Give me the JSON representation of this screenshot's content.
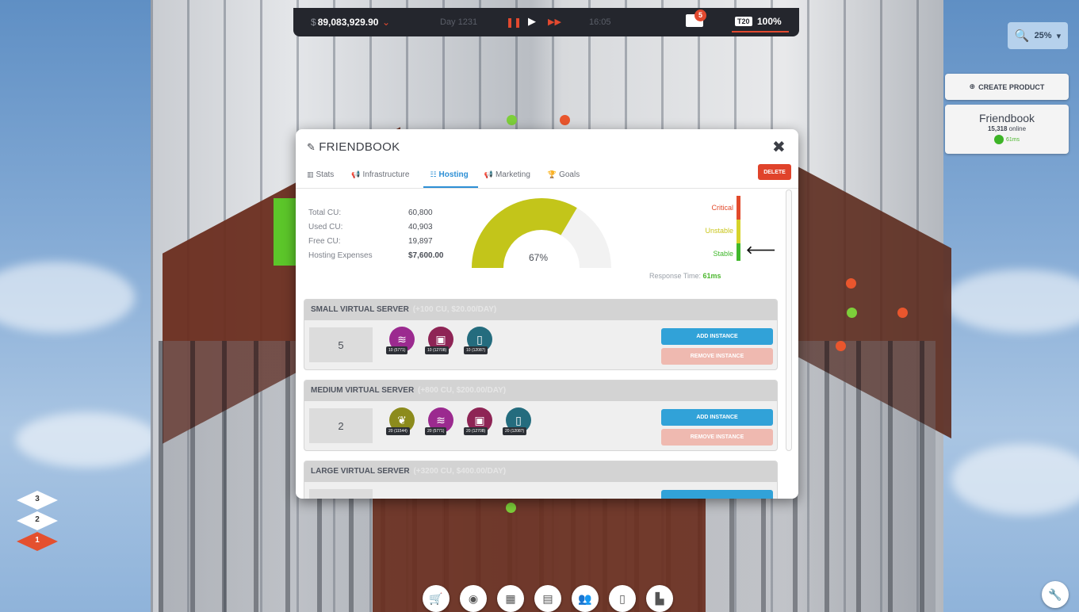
{
  "hud": {
    "currency_symbol": "$",
    "money": "89,083,929.90",
    "day": "Day 1231",
    "time": "16:05",
    "mail_count": "5",
    "perf_tag": "T20",
    "perf_value": "100%"
  },
  "zoom": {
    "value": "25%"
  },
  "side_panel": {
    "create_label": "CREATE PRODUCT",
    "product_name": "Friendbook",
    "online_count": "15,318",
    "online_suffix": "online",
    "latency": "61ms"
  },
  "floors": [
    "3",
    "2",
    "1"
  ],
  "active_floor": "1",
  "modal": {
    "title": "FRIENDBOOK",
    "delete_label": "DELETE",
    "tabs": [
      {
        "label": "Stats",
        "icon": "bar-chart-icon"
      },
      {
        "label": "Infrastructure",
        "icon": "megaphone-icon"
      },
      {
        "label": "Hosting",
        "icon": "server-icon"
      },
      {
        "label": "Marketing",
        "icon": "megaphone-icon"
      },
      {
        "label": "Goals",
        "icon": "trophy-icon"
      }
    ],
    "active_tab": "Hosting",
    "stats": {
      "total_label": "Total CU:",
      "total_value": "60,800",
      "used_label": "Used CU:",
      "used_value": "40,903",
      "free_label": "Free CU:",
      "free_value": "19,897",
      "expenses_label": "Hosting Expenses",
      "expenses_value": "$7,600.00"
    },
    "gauge": {
      "percent_label": "67%",
      "fraction": 0.67,
      "fill_color": "#c3c51a",
      "track_color": "#f2f2f2"
    },
    "status": {
      "critical": "Critical",
      "unstable": "Unstable",
      "stable": "Stable",
      "critical_color": "#e24a2b",
      "unstable_color": "#d6d32a",
      "stable_color": "#40b82c",
      "response_label": "Response Time:",
      "response_value": "61ms"
    },
    "servers": [
      {
        "name": "SMALL VIRTUAL SERVER",
        "sub": "(+100 CU, $20.00/DAY)",
        "count": "5",
        "badges": [
          {
            "tag": "10 (5771)",
            "color": "#9b2a8f",
            "icon": "wifi-icon"
          },
          {
            "tag": "10 (12708)",
            "color": "#8e2455",
            "icon": "box-icon"
          },
          {
            "tag": "10 (12087)",
            "color": "#246c7e",
            "icon": "phone-icon"
          }
        ],
        "add_label": "ADD INSTANCE",
        "remove_label": "REMOVE INSTANCE"
      },
      {
        "name": "MEDIUM VIRTUAL SERVER",
        "sub": "(+800 CU, $200.00/DAY)",
        "count": "2",
        "badges": [
          {
            "tag": "20 (11544)",
            "color": "#8c8b1c",
            "icon": "leaf-icon"
          },
          {
            "tag": "20 (5771)",
            "color": "#9b2a8f",
            "icon": "wifi-icon"
          },
          {
            "tag": "20 (12708)",
            "color": "#8e2455",
            "icon": "box-icon"
          },
          {
            "tag": "20 (12087)",
            "color": "#246c7e",
            "icon": "phone-icon"
          }
        ],
        "add_label": "ADD INSTANCE",
        "remove_label": "REMOVE INSTANCE"
      },
      {
        "name": "LARGE VIRTUAL SERVER",
        "sub": "(+3200 CU, $400.00/DAY)"
      }
    ]
  },
  "toolbar": [
    "shop-icon",
    "camera-icon",
    "grid-icon",
    "document-icon",
    "people-icon",
    "tablet-icon",
    "chart-icon"
  ],
  "settings_icon": "wrench-icon"
}
